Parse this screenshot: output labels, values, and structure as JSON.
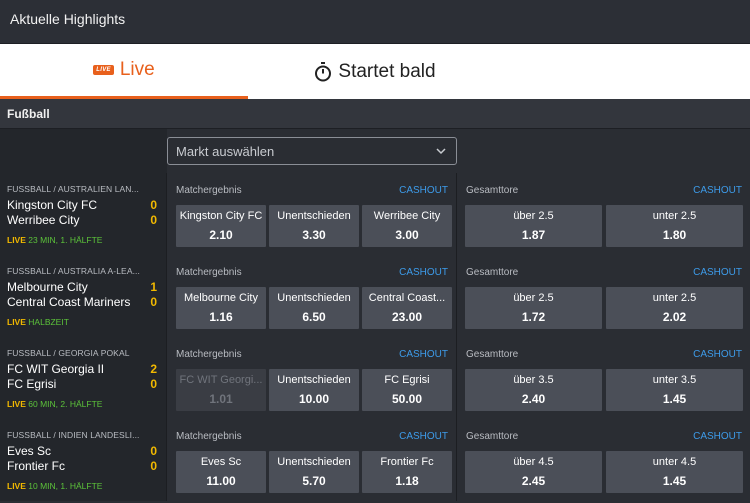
{
  "header": {
    "title": "Aktuelle Highlights"
  },
  "tabs": {
    "live": {
      "badge": "LIVE",
      "label": "Live"
    },
    "soon": {
      "label": "Startet bald"
    }
  },
  "section": {
    "label": "Fußball"
  },
  "market_select": {
    "placeholder": "Markt auswählen"
  },
  "colors": {
    "accent": "#e8601c",
    "live_status": "#f2b900",
    "time_status": "#5cc33a",
    "cashout": "#3d9be9"
  },
  "matches": [
    {
      "league": "FUSSBALL / AUSTRALIEN LAN...",
      "home": "Kingston City FC",
      "home_score": "0",
      "away": "Werribee City",
      "away_score": "0",
      "live": "LIVE",
      "time": "23 MIN, 1. HÄLFTE",
      "result_title": "Matchergebnis",
      "cashout1": "CASHOUT",
      "odds": [
        {
          "label": "Kingston City FC",
          "value": "2.10"
        },
        {
          "label": "Unentschieden",
          "value": "3.30"
        },
        {
          "label": "Werribee City",
          "value": "3.00"
        }
      ],
      "total_title": "Gesamttore",
      "cashout2": "CASHOUT",
      "totals": [
        {
          "label": "über 2.5",
          "value": "1.87"
        },
        {
          "label": "unter 2.5",
          "value": "1.80"
        }
      ]
    },
    {
      "league": "FUSSBALL / AUSTRALIA A-LEA...",
      "home": "Melbourne City",
      "home_score": "1",
      "away": "Central Coast Mariners",
      "away_score": "0",
      "live": "LIVE",
      "time": "HALBZEIT",
      "result_title": "Matchergebnis",
      "cashout1": "CASHOUT",
      "odds": [
        {
          "label": "Melbourne City",
          "value": "1.16"
        },
        {
          "label": "Unentschieden",
          "value": "6.50"
        },
        {
          "label": "Central Coast...",
          "value": "23.00"
        }
      ],
      "total_title": "Gesamttore",
      "cashout2": "CASHOUT",
      "totals": [
        {
          "label": "über 2.5",
          "value": "1.72"
        },
        {
          "label": "unter 2.5",
          "value": "2.02"
        }
      ]
    },
    {
      "league": "FUSSBALL / GEORGIA POKAL",
      "home": "FC WIT Georgia II",
      "home_score": "2",
      "away": "FC Egrisi",
      "away_score": "0",
      "live": "LIVE",
      "time": "60 MIN, 2. HÄLFTE",
      "result_title": "Matchergebnis",
      "cashout1": "CASHOUT",
      "odds": [
        {
          "label": "FC WIT Georgi...",
          "value": "1.01"
        },
        {
          "label": "Unentschieden",
          "value": "10.00"
        },
        {
          "label": "FC Egrisi",
          "value": "50.00"
        }
      ],
      "total_title": "Gesamttore",
      "cashout2": "CASHOUT",
      "totals": [
        {
          "label": "über 3.5",
          "value": "2.40"
        },
        {
          "label": "unter 3.5",
          "value": "1.45"
        }
      ]
    },
    {
      "league": "FUSSBALL / INDIEN LANDESLI...",
      "home": "Eves Sc",
      "home_score": "0",
      "away": "Frontier Fc",
      "away_score": "0",
      "live": "LIVE",
      "time": "10 MIN, 1. HÄLFTE",
      "result_title": "Matchergebnis",
      "cashout1": "CASHOUT",
      "odds": [
        {
          "label": "Eves Sc",
          "value": "11.00"
        },
        {
          "label": "Unentschieden",
          "value": "5.70"
        },
        {
          "label": "Frontier Fc",
          "value": "1.18"
        }
      ],
      "total_title": "Gesamttore",
      "cashout2": "CASHOUT",
      "totals": [
        {
          "label": "über 4.5",
          "value": "2.45"
        },
        {
          "label": "unter 4.5",
          "value": "1.45"
        }
      ]
    }
  ]
}
